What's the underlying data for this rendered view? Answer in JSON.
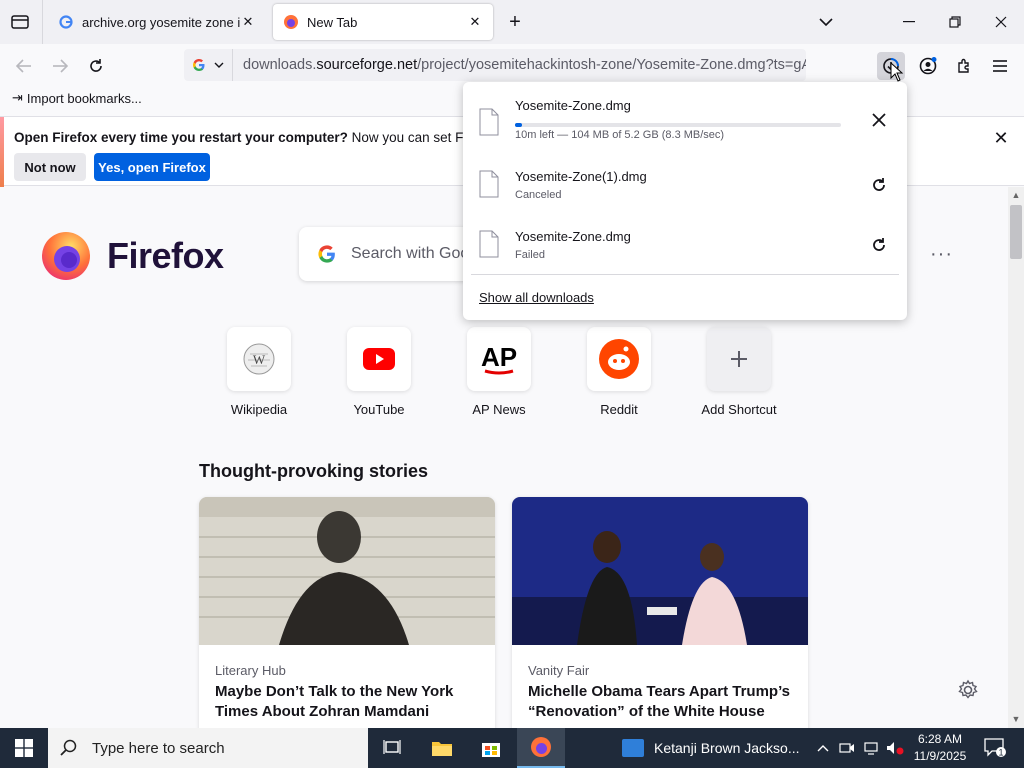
{
  "tabs": [
    {
      "title": "archive.org yosemite zone iso -",
      "favicon": "google-icon"
    },
    {
      "title": "New Tab",
      "favicon": "firefox-icon"
    }
  ],
  "navbar": {
    "url_prefix": "downloads.",
    "url_domain": "sourceforge.net",
    "url_rest": "/project/yosemitehackintosh-zone/Yosemite-Zone.dmg?ts=gAAA"
  },
  "bookmarks": {
    "import_label": "Import bookmarks..."
  },
  "notification": {
    "bold": "Open Firefox every time you restart your computer?",
    "text": "Now you can set Firefox to o",
    "not_now": "Not now",
    "yes": "Yes, open Firefox"
  },
  "newtab": {
    "brand": "Firefox",
    "search_placeholder": "Search with Goo",
    "shortcuts": [
      {
        "label": "Wikipedia"
      },
      {
        "label": "YouTube"
      },
      {
        "label": "AP News"
      },
      {
        "label": "Reddit"
      },
      {
        "label": "Add Shortcut"
      }
    ],
    "stories_title": "Thought-provoking stories",
    "stories": [
      {
        "source": "Literary Hub",
        "headline": "Maybe Don’t Talk to the New York Times About Zohran Mamdani"
      },
      {
        "source": "Vanity Fair",
        "headline": "Michelle Obama Tears Apart Trump’s “Renovation” of the White House"
      }
    ]
  },
  "downloads": {
    "items": [
      {
        "name": "Yosemite-Zone.dmg",
        "status": "10m left — 104 MB of 5.2 GB (8.3 MB/sec)",
        "progress": 0.02,
        "action": "cancel"
      },
      {
        "name": "Yosemite-Zone(1).dmg",
        "status": "Canceled",
        "action": "retry"
      },
      {
        "name": "Yosemite-Zone.dmg",
        "status": "Failed",
        "action": "retry"
      }
    ],
    "show_all": "Show all downloads"
  },
  "taskbar": {
    "search_placeholder": "Type here to search",
    "news": "Ketanji Brown Jackso...",
    "time": "6:28 AM",
    "date": "11/9/2025",
    "notification_count": "1"
  },
  "colors": {
    "accent": "#0061e0",
    "taskbar": "#1f2a3a"
  }
}
